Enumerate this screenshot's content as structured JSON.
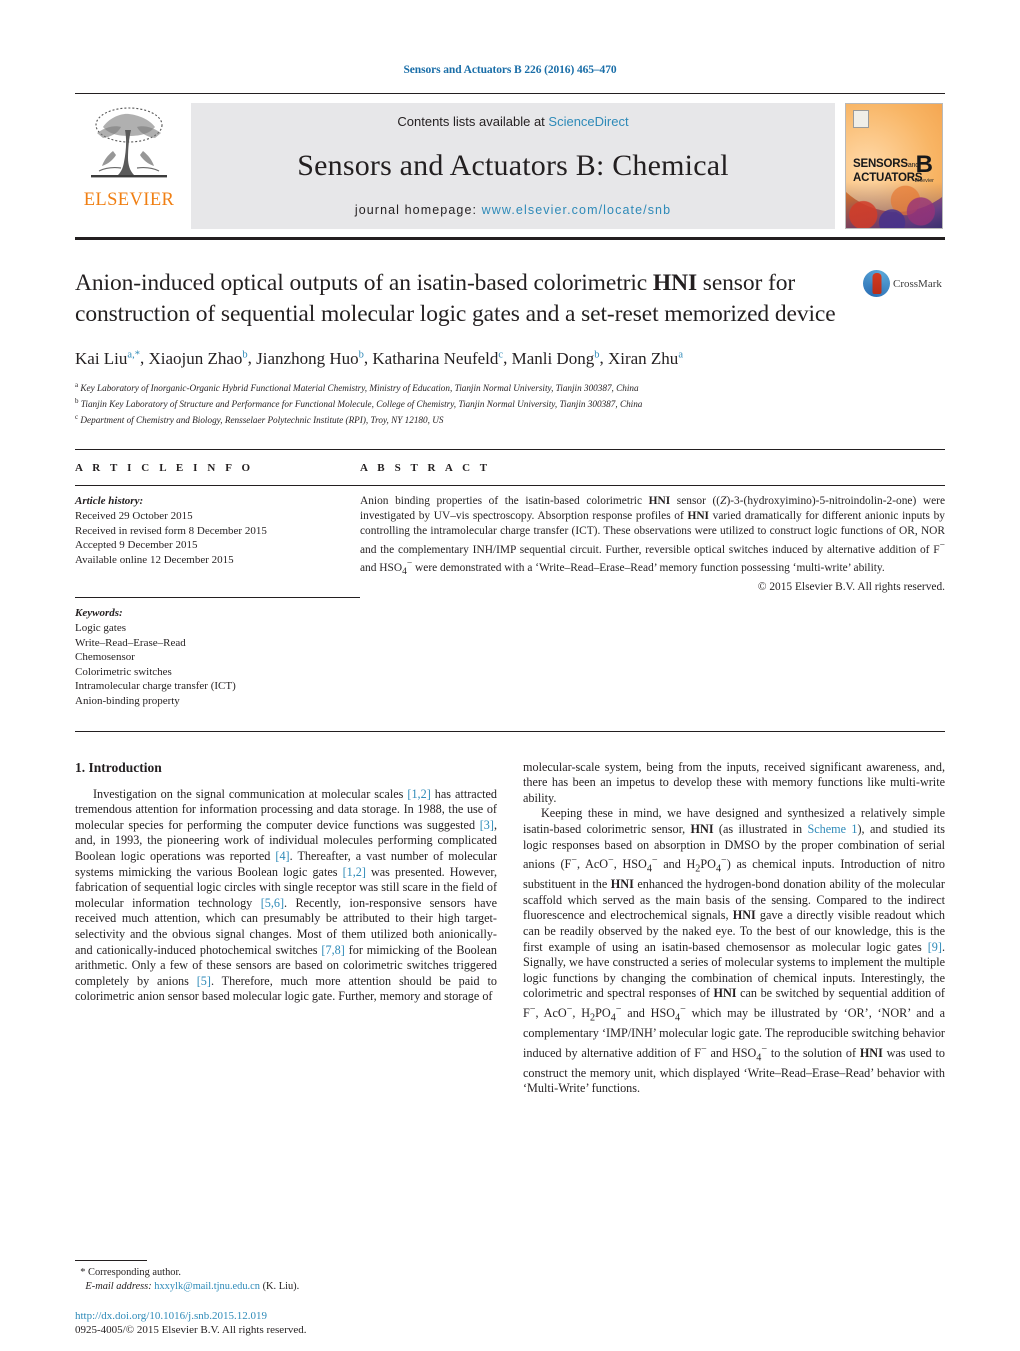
{
  "running_head": "Sensors and Actuators B 226 (2016) 465–470",
  "masthead": {
    "publisher_name": "ELSEVIER",
    "contents_prefix": "Contents lists available at ",
    "contents_link": "ScienceDirect",
    "journal_title": "Sensors and Actuators B: Chemical",
    "homepage_prefix": "journal homepage: ",
    "homepage_url": "www.elsevier.com/locate/snb",
    "cover": {
      "line1": "SENSORS",
      "line1_small": "and",
      "line2": "ACTUATORS",
      "letter": "B",
      "imprint": "Elsevier"
    },
    "link_color": "#2e8ab8"
  },
  "article": {
    "title_part1": "Anion-induced optical outputs of an isatin-based colorimetric ",
    "title_bold": "HNI",
    "title_part2": " sensor for construction of sequential molecular logic gates and a set-reset memorized device",
    "crossmark_label": "CrossMark",
    "authors": [
      {
        "name": "Kai Liu",
        "sup": "a,*"
      },
      {
        "name": "Xiaojun Zhao",
        "sup": "b"
      },
      {
        "name": "Jianzhong Huo",
        "sup": "b"
      },
      {
        "name": "Katharina Neufeld",
        "sup": "c"
      },
      {
        "name": "Manli Dong",
        "sup": "b"
      },
      {
        "name": "Xiran Zhu",
        "sup": "a"
      }
    ],
    "affiliations": [
      {
        "sup": "a",
        "text": "Key Laboratory of Inorganic-Organic Hybrid Functional Material Chemistry, Ministry of Education, Tianjin Normal University, Tianjin 300387, China"
      },
      {
        "sup": "b",
        "text": "Tianjin Key Laboratory of Structure and Performance for Functional Molecule, College of Chemistry, Tianjin Normal University, Tianjin 300387, China"
      },
      {
        "sup": "c",
        "text": "Department of Chemistry and Biology, Rensselaer Polytechnic Institute (RPI), Troy, NY 12180, US"
      }
    ]
  },
  "info": {
    "label": "A R T I C L E    I N F O",
    "history_heading": "Article history:",
    "history": [
      "Received 29 October 2015",
      "Received in revised form 8 December 2015",
      "Accepted 9 December 2015",
      "Available online 12 December 2015"
    ],
    "keywords_heading": "Keywords:",
    "keywords": [
      "Logic gates",
      "Write–Read–Erase–Read",
      "Chemosensor",
      "Colorimetric switches",
      "Intramolecular charge transfer (ICT)",
      "Anion-binding property"
    ]
  },
  "abstract": {
    "label": "A B S T R A C T",
    "text": "Anion binding properties of the isatin-based colorimetric HNI sensor ((Z)-3-(hydroxyimino)-5-nitroindolin-2-one) were investigated by UV–vis spectroscopy. Absorption response profiles of HNI varied dramatically for different anionic inputs by controlling the intramolecular charge transfer (ICT). These observations were utilized to construct logic functions of OR, NOR and the complementary INH/IMP sequential circuit. Further, reversible optical switches induced by alternative addition of F− and HSO4− were demonstrated with a ‘Write–Read–Erase–Read’ memory function possessing ‘multi-write’ ability.",
    "copyright": "© 2015 Elsevier B.V. All rights reserved."
  },
  "body": {
    "section_heading": "1.  Introduction",
    "left_paragraph_1": "Investigation on the signal communication at molecular scales [1,2] has attracted tremendous attention for information processing and data storage. In 1988, the use of molecular species for performing the computer device functions was suggested [3], and, in 1993, the pioneering work of individual molecules performing complicated Boolean logic operations was reported [4]. Thereafter, a vast number of molecular systems mimicking the various Boolean logic gates [1,2] was presented. However, fabrication of sequential logic circles with single receptor was still scare in the field of molecular information technology [5,6]. Recently, ion-responsive sensors have received much attention, which can presumably be attributed to their high target-selectivity and the obvious signal changes. Most of them utilized both anionically- and cationically-induced photochemical switches [7,8] for mimicking of the Boolean arithmetic. Only a few of these sensors are based on colorimetric switches triggered completely by anions [5]. Therefore, much more attention should be paid to colorimetric anion sensor based molecular logic gate. Further, memory and storage of",
    "right_paragraph_1": "molecular-scale system, being from the inputs, received significant awareness, and, there has been an impetus to develop these with memory functions like multi-write ability.",
    "right_paragraph_2": "Keeping these in mind, we have designed and synthesized a relatively simple isatin-based colorimetric sensor, HNI (as illustrated in Scheme 1), and studied its logic responses based on absorption in DMSO by the proper combination of serial anions (F−, AcO−, HSO4− and H2PO4−) as chemical inputs. Introduction of nitro substituent in the HNI enhanced the hydrogen-bond donation ability of the molecular scaffold which served as the main basis of the sensing. Compared to the indirect fluorescence and electrochemical signals, HNI gave a directly visible readout which can be readily observed by the naked eye. To the best of our knowledge, this is the first example of using an isatin-based chemosensor as molecular logic gates [9]. Signally, we have constructed a series of molecular systems to implement the multiple logic functions by changing the combination of chemical inputs. Interestingly, the colorimetric and spectral responses of HNI can be switched by sequential addition of F−, AcO−, H2PO4− and HSO4− which may be illustrated by ‘OR’, ‘NOR’ and a complementary ‘IMP/INH’ molecular logic gate. The reproducible switching behavior induced by alternative addition of F− and HSO4− to the solution of HNI was used to construct the memory unit, which displayed ‘Write–Read–Erase–Read’ behavior with ‘Multi-Write’ functions."
  },
  "footnotes": {
    "corresponding_marker": "*",
    "corresponding_label": "Corresponding author.",
    "email_label": "E-mail address:",
    "email": "hxxylk@mail.tjnu.edu.cn",
    "email_owner": "(K. Liu).",
    "doi": "http://dx.doi.org/10.1016/j.snb.2015.12.019",
    "issn_line": "0925-4005/© 2015 Elsevier B.V. All rights reserved."
  }
}
